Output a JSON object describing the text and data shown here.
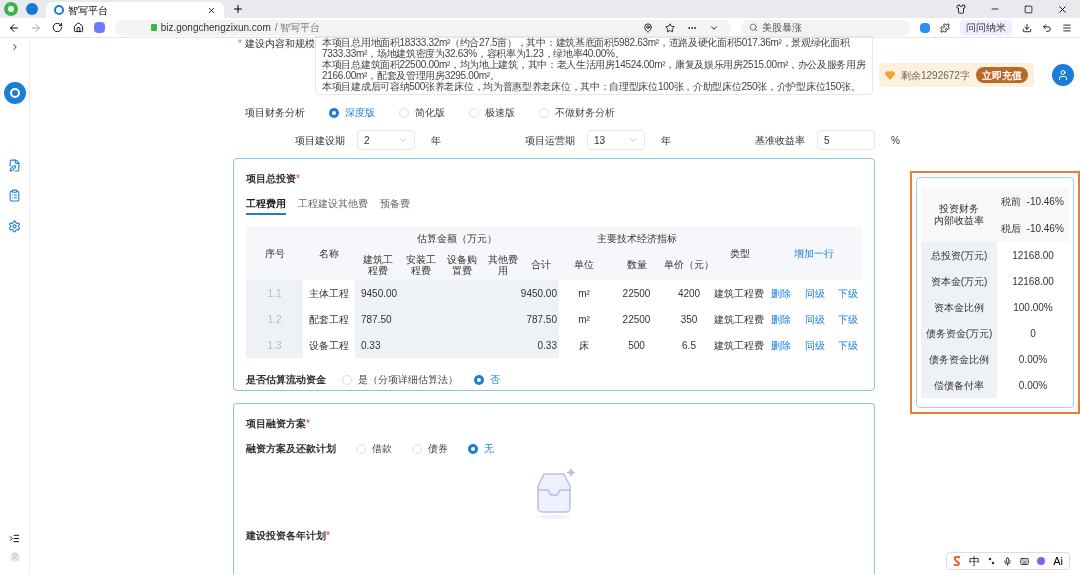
{
  "browser": {
    "tab_title": "智写平台",
    "url_host": "biz.gongchengzixun.com",
    "url_path": " / 智写平台",
    "search": "美股暴涨",
    "extension_label": "问问纳米"
  },
  "scope": {
    "required_mark": "*",
    "label": "建设内容和规模",
    "paragraphs": [
      "本项目总用地面积18333.32m²（约合27.5亩），其中：建筑基底面积5982.63m²，道路及硬化面积5017.36m²，景观绿化面积7333.33m²，场地建筑密度为32.63%，容积率为1.23，绿地率40.00%。",
      "本项目总建筑面积22500.00m²，均为地上建筑，其中：老人生活用房14524.00m²，康复及娱乐用房2515.00m²，办公及服务用房2166.00m²，配套及管理用房3295.00m²。",
      "本项目建成后可容纳500张养老床位，均为普惠型养老床位，其中：自理型床位100张，介助型床位250张，介护型床位150张。"
    ]
  },
  "analysis": {
    "label": "项目财务分析",
    "options": [
      {
        "label": "深度版",
        "selected": true
      },
      {
        "label": "简化版",
        "selected": false
      },
      {
        "label": "极速版",
        "selected": false
      },
      {
        "label": "不做财务分析",
        "selected": false
      }
    ]
  },
  "periods": [
    {
      "label": "项目建设期",
      "value": "2",
      "unit": "年",
      "kind": "select"
    },
    {
      "label": "项目运营期",
      "value": "13",
      "unit": "年",
      "kind": "select"
    },
    {
      "label": "基准收益率",
      "value": "5",
      "unit": "%",
      "kind": "input"
    }
  ],
  "investment": {
    "title": "项目总投资",
    "required_mark": "*",
    "tabs": [
      {
        "label": "工程费用",
        "selected": true
      },
      {
        "label": "工程建设其他费",
        "selected": false
      },
      {
        "label": "预备费",
        "selected": false
      }
    ],
    "table": {
      "index_header": "序号",
      "name_header": "名称",
      "money_group": "估算金额（万元）",
      "money_columns": [
        "建筑工程费",
        "安装工程费",
        "设备购置费",
        "其他费用",
        "合计"
      ],
      "tech_group": "主要技术经济指标",
      "tech_columns": [
        "单位",
        "数量",
        "单价（元）"
      ],
      "type_header": "类型",
      "add_row": "增加一行",
      "rows": [
        {
          "index": "1.1",
          "name": "主体工程",
          "building_cost": "9450.00",
          "total": "9450.00",
          "unit": "m²",
          "quantity": "22500",
          "price": "4200",
          "type": "建筑工程费",
          "actions": [
            "删除",
            "同级",
            "下级"
          ]
        },
        {
          "index": "1.2",
          "name": "配套工程",
          "building_cost": "787.50",
          "total": "787.50",
          "unit": "m²",
          "quantity": "22500",
          "price": "350",
          "type": "建筑工程费",
          "actions": [
            "删除",
            "同级",
            "下级"
          ]
        },
        {
          "index": "1.3",
          "name": "设备工程",
          "building_cost": "0.33",
          "total": "0.33",
          "unit": "床",
          "quantity": "500",
          "price": "6.5",
          "type": "建筑工程费",
          "actions": [
            "删除",
            "同级",
            "下级"
          ]
        }
      ]
    },
    "working_capital": {
      "label": "是否估算流动资金",
      "options": [
        {
          "label": "是（分项详细估算法）",
          "selected": false
        },
        {
          "label": "否",
          "selected": true
        }
      ]
    }
  },
  "financing": {
    "title": "项目融资方案",
    "required_mark": "*",
    "next_required_mark": "*",
    "plan_label": "融资方案及还款计划",
    "options": [
      {
        "label": "借款",
        "selected": false
      },
      {
        "label": "债券",
        "selected": false
      },
      {
        "label": "无",
        "selected": true
      }
    ],
    "next_title": "建设投资各年计划"
  },
  "quota": {
    "text": "剩余1292672字",
    "button": "立即充值"
  },
  "summary": {
    "irr_label": [
      "投资财务",
      "内部收益率"
    ],
    "irr": [
      {
        "label": "税前",
        "value": "-10.46%"
      },
      {
        "label": "税后",
        "value": "-10.46%"
      }
    ],
    "rows": [
      {
        "label": "总投资(万元)",
        "value": "12168.00"
      },
      {
        "label": "资本金(万元)",
        "value": "12168.00"
      },
      {
        "label": "资本金比例",
        "value": "100.00%"
      },
      {
        "label": "债务资金(万元)",
        "value": "0"
      },
      {
        "label": "债务资金比例",
        "value": "0.00%"
      },
      {
        "label": "偿债备付率",
        "value": "0.00%"
      }
    ]
  },
  "ime": [
    "中",
    "Ai"
  ]
}
